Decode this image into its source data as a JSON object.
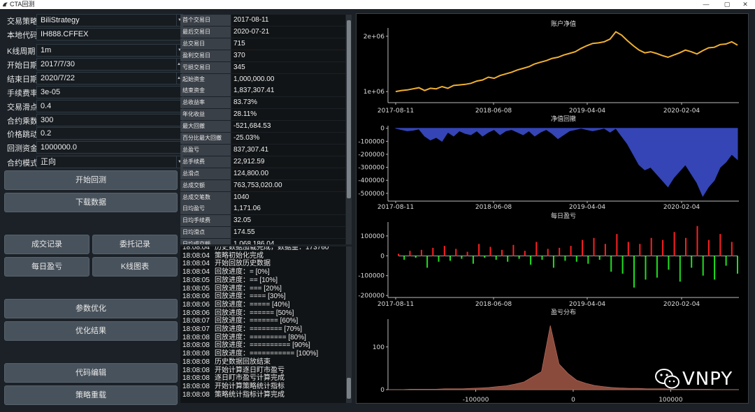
{
  "window": {
    "title": "CTA回测",
    "min_icon": "minimize-icon",
    "max_icon": "maximize-icon",
    "close_icon": "close-icon"
  },
  "form": {
    "strategy": {
      "label": "交易策略",
      "value": "BiliStrategy"
    },
    "symbol": {
      "label": "本地代码",
      "value": "IH888.CFFEX"
    },
    "interval": {
      "label": "K线周期",
      "value": "1m"
    },
    "start": {
      "label": "开始日期",
      "value": "2017/7/30"
    },
    "end": {
      "label": "结束日期",
      "value": "2020/7/22"
    },
    "rate": {
      "label": "手续费率",
      "value": "3e-05"
    },
    "slippage": {
      "label": "交易滑点",
      "value": "0.4"
    },
    "size": {
      "label": "合约乘数",
      "value": "300"
    },
    "pricetick": {
      "label": "价格跳动",
      "value": "0.2"
    },
    "capital": {
      "label": "回测资金",
      "value": "1000000.0"
    },
    "mode": {
      "label": "合约模式",
      "value": "正向"
    }
  },
  "buttons": {
    "backtest": "开始回测",
    "download": "下载数据",
    "trades": "成交记录",
    "orders": "委托记录",
    "daily": "每日盈亏",
    "kline": "K线图表",
    "optimize": "参数优化",
    "opt_result": "优化结果",
    "edit": "代码编辑",
    "reload": "策略重载"
  },
  "stats": [
    {
      "key": "首个交易日",
      "value": "2017-08-11"
    },
    {
      "key": "最后交易日",
      "value": "2020-07-21"
    },
    {
      "key": "总交易日",
      "value": "715"
    },
    {
      "key": "盈利交易日",
      "value": "370"
    },
    {
      "key": "亏损交易日",
      "value": "345"
    },
    {
      "key": "起始资金",
      "value": "1,000,000.00"
    },
    {
      "key": "结束资金",
      "value": "1,837,307.41"
    },
    {
      "key": "总收益率",
      "value": "83.73%"
    },
    {
      "key": "年化收益",
      "value": "28.11%"
    },
    {
      "key": "最大回撤",
      "value": "-521,684.53"
    },
    {
      "key": "百分比最大回撤",
      "value": "-25.03%"
    },
    {
      "key": "总盈亏",
      "value": "837,307.41"
    },
    {
      "key": "总手续费",
      "value": "22,912.59"
    },
    {
      "key": "总滑点",
      "value": "124,800.00"
    },
    {
      "key": "总成交额",
      "value": "763,753,020.00"
    },
    {
      "key": "总成交笔数",
      "value": "1040"
    },
    {
      "key": "日均盈亏",
      "value": "1,171.06"
    },
    {
      "key": "日均手续费",
      "value": "32.05"
    },
    {
      "key": "日均滑点",
      "value": "174.55"
    },
    {
      "key": "日均成交额",
      "value": "1,068,186.04"
    }
  ],
  "log": [
    {
      "time": "18:08:04",
      "msg": "历史数据加载完成，数据量：173760"
    },
    {
      "time": "18:08:04",
      "msg": "策略初始化完成"
    },
    {
      "time": "18:08:04",
      "msg": "开始回放历史数据"
    },
    {
      "time": "18:08:04",
      "msg": "回放进度：= [0%]"
    },
    {
      "time": "18:08:05",
      "msg": "回放进度：== [10%]"
    },
    {
      "time": "18:08:05",
      "msg": "回放进度：=== [20%]"
    },
    {
      "time": "18:08:06",
      "msg": "回放进度：==== [30%]"
    },
    {
      "time": "18:08:06",
      "msg": "回放进度：===== [40%]"
    },
    {
      "time": "18:08:06",
      "msg": "回放进度：====== [50%]"
    },
    {
      "time": "18:08:07",
      "msg": "回放进度：======= [60%]"
    },
    {
      "time": "18:08:07",
      "msg": "回放进度：======== [70%]"
    },
    {
      "time": "18:08:08",
      "msg": "回放进度：========= [80%]"
    },
    {
      "time": "18:08:08",
      "msg": "回放进度：========== [90%]"
    },
    {
      "time": "18:08:08",
      "msg": "回放进度：=========== [100%]"
    },
    {
      "time": "18:08:08",
      "msg": "历史数据回放结束"
    },
    {
      "time": "18:08:08",
      "msg": "开始计算逐日盯市盈亏"
    },
    {
      "time": "18:08:08",
      "msg": "逐日盯市盈亏计算完成"
    },
    {
      "time": "18:08:08",
      "msg": "开始计算策略统计指标"
    },
    {
      "time": "18:08:08",
      "msg": "策略统计指标计算完成"
    }
  ],
  "watermark": "VNPY",
  "colors": {
    "balance": "#f0b030",
    "drawdown": "#3545b5",
    "profit": "#ff2020",
    "loss": "#20e020",
    "distribution": "#8a4a3c"
  },
  "chart_data": [
    {
      "type": "line",
      "title": "账户净值",
      "x_ticks": [
        "2017-08-11",
        "2018-06-08",
        "2019-04-04",
        "2020-02-04"
      ],
      "y_ticks": [
        "1e+06",
        "2e+06"
      ],
      "ylim": [
        800000,
        2150000
      ],
      "series": [
        {
          "values": [
            1000000,
            1020000,
            1030000,
            1050000,
            1070000,
            1020000,
            1060000,
            1050000,
            1090000,
            1060000,
            1110000,
            1120000,
            1130000,
            1150000,
            1190000,
            1210000,
            1260000,
            1240000,
            1290000,
            1320000,
            1350000,
            1390000,
            1420000,
            1450000,
            1500000,
            1530000,
            1560000,
            1600000,
            1620000,
            1660000,
            1690000,
            1720000,
            1780000,
            1830000,
            1870000,
            1880000,
            1900000,
            1950000,
            2080000,
            2020000,
            1920000,
            1830000,
            1750000,
            1700000,
            1720000,
            1690000,
            1650000,
            1620000,
            1660000,
            1700000,
            1750000,
            1720000,
            1680000,
            1740000,
            1790000,
            1800000,
            1850000,
            1860000,
            1900000,
            1840000
          ]
        }
      ]
    },
    {
      "type": "area",
      "title": "净值回撤",
      "x_ticks": [
        "2017-08-11",
        "2018-06-08",
        "2019-04-04",
        "2020-02-04"
      ],
      "y_ticks": [
        "0",
        "-100000",
        "-200000",
        "-300000",
        "-400000",
        "-500000"
      ],
      "ylim": [
        -560000,
        20000
      ],
      "series": [
        {
          "values": [
            0,
            -10000,
            -20000,
            -15000,
            -5000,
            -60000,
            -90000,
            -70000,
            -100000,
            -30000,
            -60000,
            -20000,
            -40000,
            -50000,
            -20000,
            -60000,
            -30000,
            -10000,
            -50000,
            -20000,
            -10000,
            -30000,
            -50000,
            -20000,
            -60000,
            -30000,
            -10000,
            -40000,
            -80000,
            -50000,
            -20000,
            -10000,
            0,
            -10000,
            -20000,
            -10000,
            0,
            -30000,
            0,
            -60000,
            -120000,
            -200000,
            -280000,
            -320000,
            -300000,
            -350000,
            -400000,
            -450000,
            -380000,
            -330000,
            -280000,
            -350000,
            -420000,
            -521685,
            -450000,
            -400000,
            -300000,
            -260000,
            -200000,
            -240000
          ]
        }
      ]
    },
    {
      "type": "bar",
      "title": "每日盈亏",
      "x_ticks": [
        "2017-08-11",
        "2018-06-08",
        "2019-04-04",
        "2020-02-04"
      ],
      "y_ticks": [
        "100000",
        "0",
        "-100000",
        "-200000"
      ],
      "ylim": [
        -210000,
        170000
      ],
      "series": [
        {
          "values": [
            10000,
            -20000,
            25000,
            -10000,
            30000,
            -60000,
            40000,
            -30000,
            50000,
            -25000,
            35000,
            -15000,
            20000,
            -40000,
            60000,
            -10000,
            45000,
            -20000,
            30000,
            -30000,
            55000,
            -15000,
            25000,
            -45000,
            70000,
            -20000,
            35000,
            -60000,
            40000,
            -25000,
            50000,
            -30000,
            80000,
            -40000,
            90000,
            -20000,
            60000,
            -80000,
            110000,
            -90000,
            70000,
            -160000,
            60000,
            -120000,
            90000,
            -110000,
            80000,
            -70000,
            120000,
            -130000,
            90000,
            -60000,
            150000,
            -100000,
            80000,
            -120000,
            110000,
            -50000,
            70000,
            -90000
          ]
        }
      ]
    },
    {
      "type": "area",
      "title": "盈亏分布",
      "x_ticks": [
        "-100000",
        "0",
        "100000"
      ],
      "y_ticks": [
        "0",
        "100"
      ],
      "xlim": [
        -190000,
        170000
      ],
      "ylim": [
        0,
        165
      ],
      "series": [
        {
          "values": [
            0,
            0,
            1,
            1,
            1,
            1,
            2,
            2,
            2,
            3,
            4,
            5,
            7,
            9,
            13,
            18,
            30,
            42,
            150,
            60,
            38,
            22,
            15,
            10,
            7,
            5,
            4,
            3,
            3,
            2,
            2,
            2,
            1,
            1,
            1,
            1,
            1,
            0,
            0,
            0
          ]
        }
      ]
    }
  ]
}
